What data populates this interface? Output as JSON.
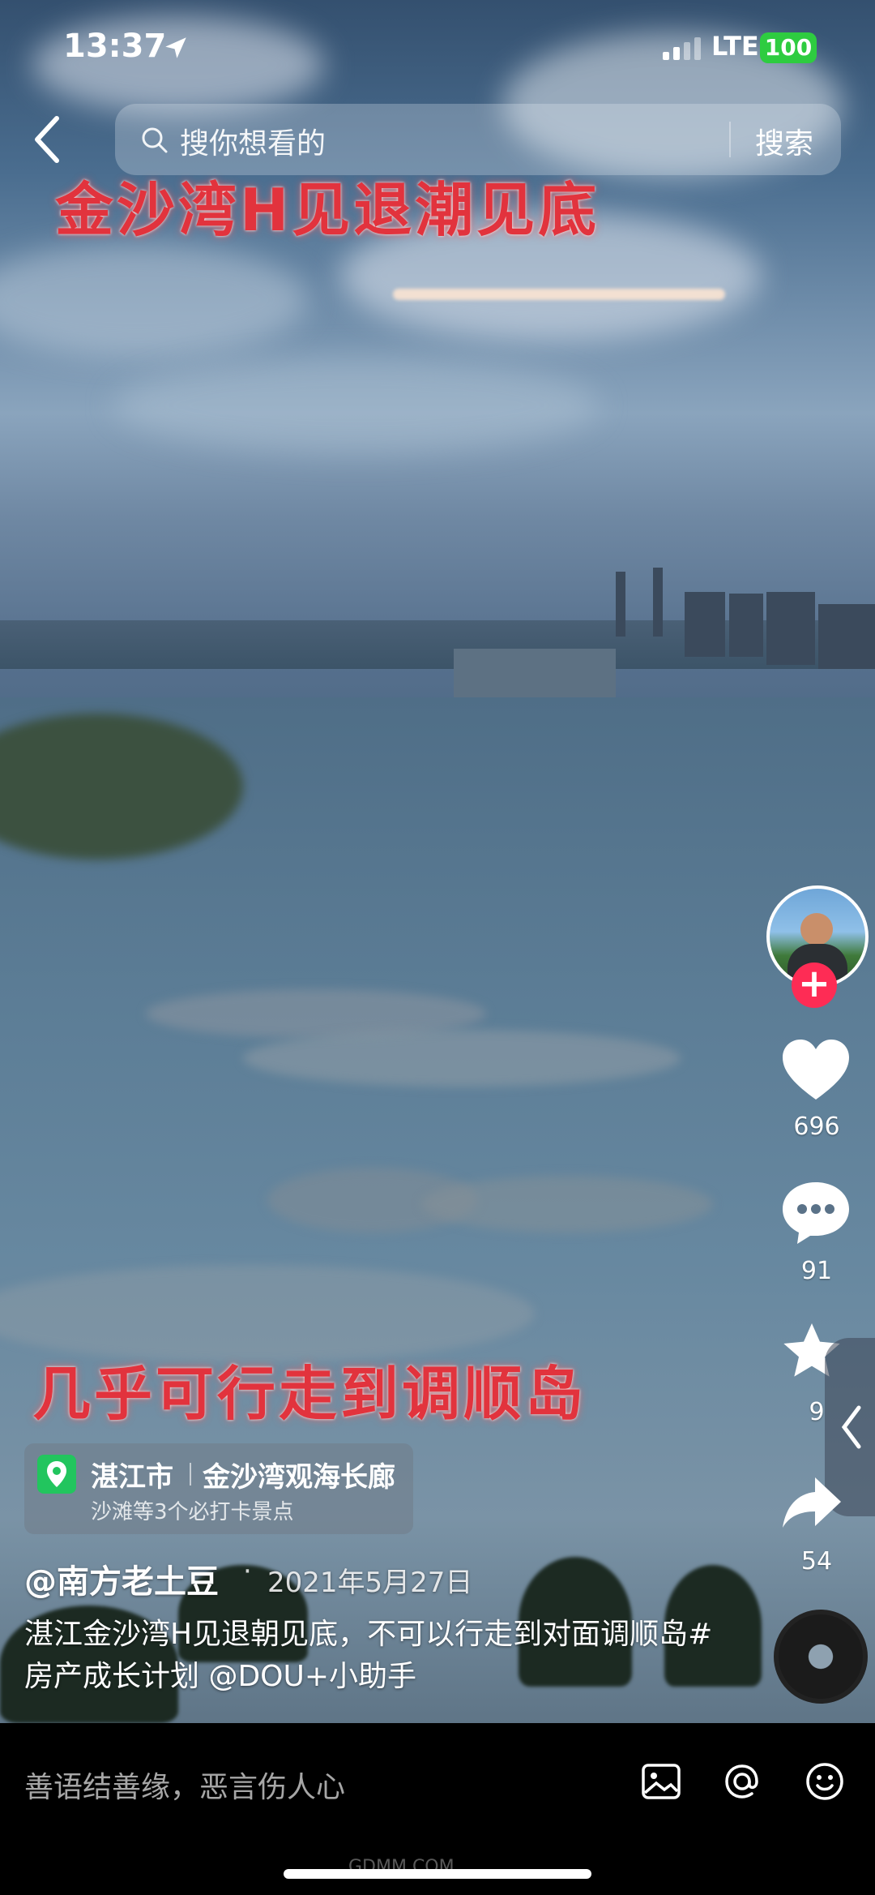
{
  "status_bar": {
    "time": "13:37",
    "network": "LTE",
    "battery": "100",
    "icons": [
      "location-arrow-icon",
      "signal-icon",
      "battery-icon"
    ]
  },
  "search": {
    "placeholder": "搜你想看的",
    "button_label": "搜索"
  },
  "video": {
    "overlay_top": "金沙湾H见退潮见底",
    "overlay_bottom": "几乎可行走到调顺岛"
  },
  "actions": {
    "likes": "696",
    "comments": "91",
    "favorites": "9",
    "shares": "54"
  },
  "location": {
    "city": "湛江市",
    "place": "金沙湾观海长廊",
    "subtitle": "沙滩等3个必打卡景点"
  },
  "post": {
    "author": "@南方老土豆",
    "separator": "·",
    "date": "2021年5月27日",
    "caption": "湛江金沙湾H见退朝见底，不可以行走到对面调顺岛#房产成长计划 @DOU+小助手"
  },
  "comment_bar": {
    "placeholder": "善语结善缘，恶言伤人心",
    "watermark": "GDMM.COM"
  },
  "colors": {
    "accent": "#fe2c55",
    "battery": "#2ecc40",
    "location_pin": "#22c55e",
    "overlay_text": "#e2333d"
  }
}
